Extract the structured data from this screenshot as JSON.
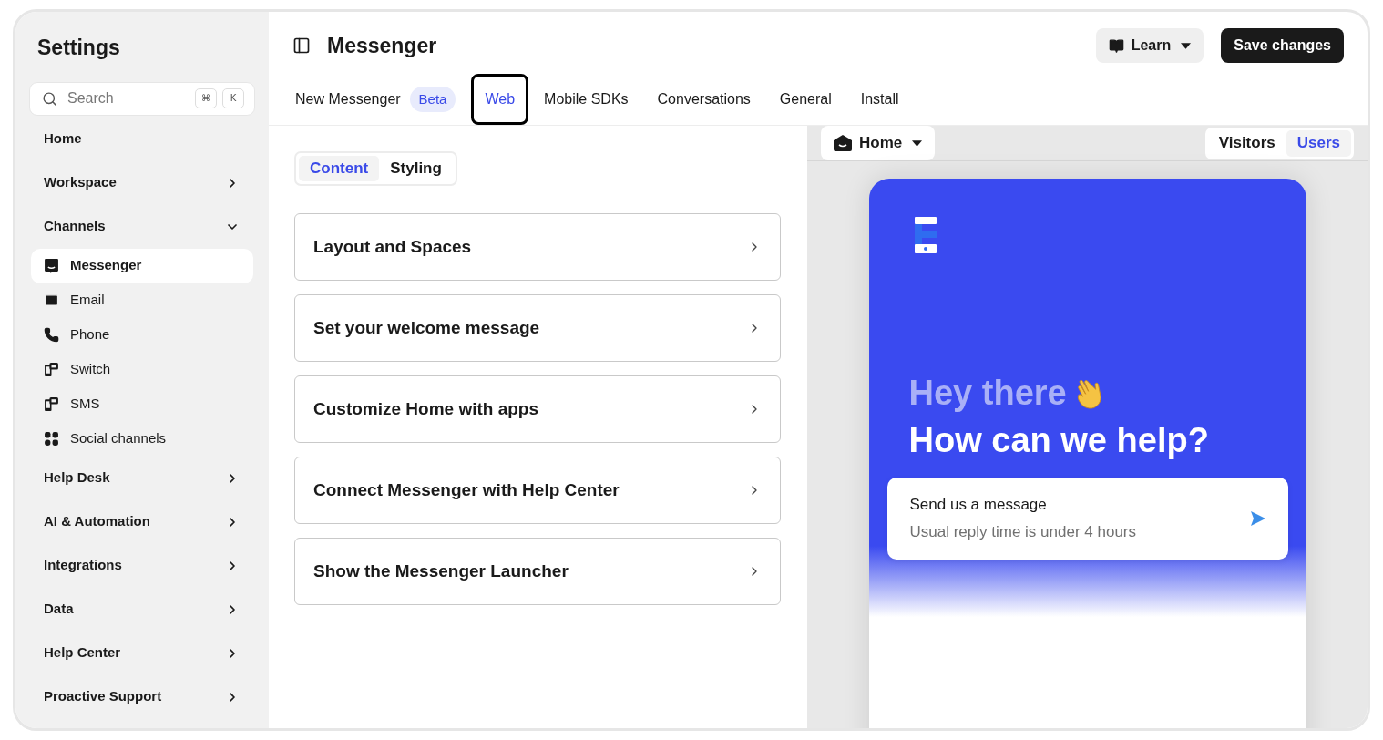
{
  "sidebar": {
    "title": "Settings",
    "search": {
      "placeholder": "Search",
      "keys": [
        "⌘",
        "K"
      ]
    },
    "nav": [
      {
        "label": "Home",
        "kind": "link"
      },
      {
        "label": "Workspace",
        "kind": "group",
        "expanded": false
      },
      {
        "label": "Channels",
        "kind": "group",
        "expanded": true,
        "children": [
          {
            "label": "Messenger",
            "kind": "messenger",
            "selected": true
          },
          {
            "label": "Email",
            "kind": "email",
            "selected": false
          },
          {
            "label": "Phone",
            "kind": "phone",
            "selected": false
          },
          {
            "label": "Switch",
            "kind": "switch",
            "selected": false
          },
          {
            "label": "SMS",
            "kind": "sms",
            "selected": false
          },
          {
            "label": "Social channels",
            "kind": "social",
            "selected": false
          }
        ]
      },
      {
        "label": "Help Desk",
        "kind": "group",
        "expanded": false
      },
      {
        "label": "AI & Automation",
        "kind": "group",
        "expanded": false
      },
      {
        "label": "Integrations",
        "kind": "group",
        "expanded": false
      },
      {
        "label": "Data",
        "kind": "group",
        "expanded": false
      },
      {
        "label": "Help Center",
        "kind": "group",
        "expanded": false
      },
      {
        "label": "Proactive Support",
        "kind": "group",
        "expanded": false
      }
    ]
  },
  "header": {
    "title": "Messenger",
    "learn_button": "Learn",
    "save_button": "Save changes"
  },
  "tabs": [
    {
      "label": "New Messenger",
      "badge": "Beta",
      "selected": false
    },
    {
      "label": "Web",
      "selected": true
    },
    {
      "label": "Mobile SDKs",
      "selected": false
    },
    {
      "label": "Conversations",
      "selected": false
    },
    {
      "label": "General",
      "selected": false
    },
    {
      "label": "Install",
      "selected": false
    }
  ],
  "segments": [
    {
      "label": "Content",
      "selected": true
    },
    {
      "label": "Styling",
      "selected": false
    }
  ],
  "sections": [
    "Layout and Spaces",
    "Set your welcome message",
    "Customize Home with apps",
    "Connect Messenger with Help Center",
    "Show the Messenger Launcher"
  ],
  "preview": {
    "page_select": "Home",
    "audience": [
      {
        "label": "Visitors",
        "selected": false
      },
      {
        "label": "Users",
        "selected": true
      }
    ],
    "greeting": "Hey there",
    "headline": "How can we help?",
    "card": {
      "title": "Send us a message",
      "subtitle": "Usual reply time is under 4 hours"
    }
  }
}
